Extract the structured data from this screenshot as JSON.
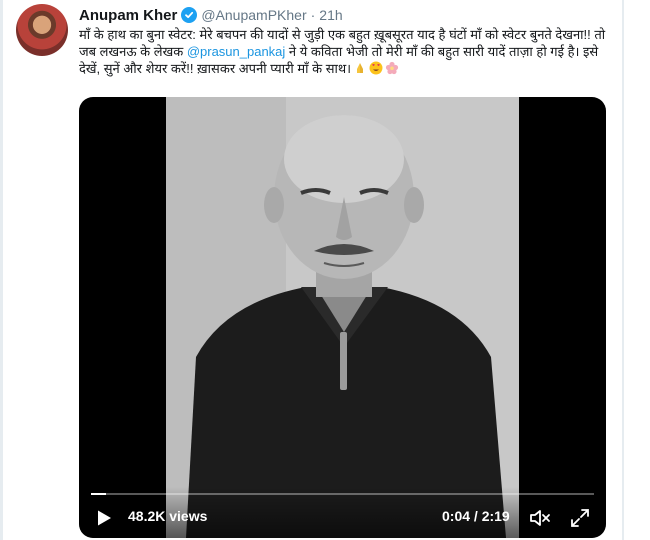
{
  "tweet": {
    "author_name": "Anupam Kher",
    "handle": "@AnupamPKher",
    "separator": "·",
    "time": "21h",
    "text_before": "माँ के हाथ का बुना स्वेटर: मेरे बचपन की यादों से जुड़ी एक बहुत ख़ूबसूरत याद है घंटों माँ को स्वेटर बुनते देखना!! तो जब लखनऊ के लेखक ",
    "mention": "@prasun_pankaj",
    "text_after": " ने ये कविता भेजी तो मेरी माँ की बहुत सारी यादें ताज़ा हो गई है। इसे देखें, सुनें और शेयर करें!! ख़ासकर अपनी प्यारी माँ के साथ।",
    "emojis": [
      "folded-hands-icon",
      "heart-eyes-icon",
      "blossom-icon"
    ]
  },
  "video": {
    "views": "48.2K views",
    "timecode": "0:04 / 2:19",
    "progress": 0.03
  },
  "colors": {
    "link": "#1b95e0",
    "verified": "#1da1f2",
    "muted": "#657786"
  }
}
